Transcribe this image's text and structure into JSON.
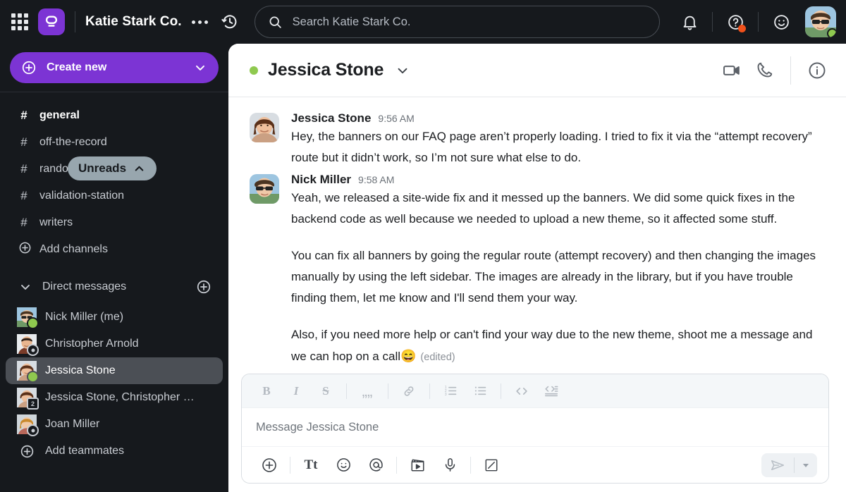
{
  "topbar": {
    "app_launcher_icon": "grid-apps-icon",
    "brand_logo_icon": "pumble-logo-icon",
    "workspace_name": "Katie Stark Co.",
    "more_icon": "ellipsis-icon",
    "history_icon": "history-clock-icon",
    "search": {
      "placeholder": "Search Katie Stark Co.",
      "icon": "search-icon"
    },
    "notifications_icon": "bell-icon",
    "help_icon": "help-question-icon",
    "help_badge": true,
    "status_emoji_icon": "smiley-face-icon",
    "avatar_name": "Nick Miller",
    "avatar_status": "online"
  },
  "sidebar": {
    "create_new": {
      "label": "Create new",
      "plus_icon": "plus-circle-icon",
      "caret_icon": "chevron-down-icon"
    },
    "unreads_pill": {
      "label": "Unreads",
      "icon": "chevron-up-icon"
    },
    "channels": [
      {
        "name": "general",
        "icon": "hash-icon",
        "unread": true
      },
      {
        "name": "off-the-record",
        "icon": "hash-icon",
        "unread": false
      },
      {
        "name": "random",
        "icon": "hash-icon",
        "unread": false
      },
      {
        "name": "validation-station",
        "icon": "hash-icon",
        "unread": false
      },
      {
        "name": "writers",
        "icon": "hash-icon",
        "unread": false
      }
    ],
    "add_channels": {
      "label": "Add channels",
      "icon": "plus-circle-icon"
    },
    "dm_section": {
      "label": "Direct messages",
      "caret_icon": "chevron-down-icon",
      "add_icon": "plus-circle-icon"
    },
    "dms": [
      {
        "name": "Nick Miller (me)",
        "status": "online",
        "selected": false
      },
      {
        "name": "Christopher Arnold",
        "status": "away",
        "selected": false
      },
      {
        "name": "Jessica Stone",
        "status": "online",
        "selected": true
      },
      {
        "name": "Jessica Stone, Christopher …",
        "status": "group",
        "group_count": "2",
        "selected": false
      },
      {
        "name": "Joan Miller",
        "status": "away",
        "selected": false
      }
    ],
    "add_teammates": {
      "label": "Add teammates",
      "icon": "plus-circle-icon"
    }
  },
  "chat": {
    "header": {
      "title": "Jessica Stone",
      "presence": "online",
      "caret_icon": "chevron-down-icon",
      "video_icon": "video-camera-icon",
      "call_icon": "phone-icon",
      "info_icon": "info-circle-icon"
    },
    "messages": [
      {
        "author": "Jessica Stone",
        "time": "9:56 AM",
        "paragraphs": [
          "Hey, the banners on our FAQ page aren’t properly loading. I tried to fix it via the “attempt recovery” route but it didn’t work, so I’m not sure what else to do."
        ],
        "edited": false
      },
      {
        "author": "Nick Miller",
        "time": "9:58 AM",
        "paragraphs": [
          "Yeah, we released a site-wide fix and it messed up the banners. We did some quick fixes in the backend code as well because we needed to upload a new theme, so it affected some stuff.",
          "You can fix all banners by going the regular route (attempt recovery) and then changing the images manually by using the left sidebar. The images are already in the library, but if you have trouble finding them, let me know and I'll send them your way.",
          "Also, if you need more help or can't find your way due to the new theme, shoot me a message and we can hop on a call"
        ],
        "trailing_emoji": "😄",
        "edited": true,
        "edited_label": "(edited)"
      }
    ]
  },
  "composer": {
    "placeholder": "Message Jessica Stone",
    "format_tools": [
      {
        "name": "bold-button",
        "label": "B"
      },
      {
        "name": "italic-button",
        "label": "I"
      },
      {
        "name": "strikethrough-button",
        "label": "S"
      },
      {
        "name": "blockquote-button",
        "label": "❝"
      },
      {
        "name": "link-button",
        "label": "link-icon"
      },
      {
        "name": "ordered-list-button",
        "label": "ordered-list-icon"
      },
      {
        "name": "bullet-list-button",
        "label": "bullet-list-icon"
      },
      {
        "name": "inline-code-button",
        "label": "< >"
      },
      {
        "name": "code-block-button",
        "label": "code-block-icon"
      }
    ],
    "action_tools": [
      {
        "name": "attach-plus-button",
        "label": "plus-circle-icon"
      },
      {
        "name": "format-text-button",
        "label": "Tt"
      },
      {
        "name": "emoji-button",
        "label": "smiley-face-icon"
      },
      {
        "name": "mention-button",
        "label": "at-sign-icon"
      },
      {
        "name": "video-clip-button",
        "label": "clapperboard-icon"
      },
      {
        "name": "voice-record-button",
        "label": "microphone-icon"
      },
      {
        "name": "draw-button",
        "label": "slash-square-icon"
      }
    ],
    "send": {
      "icon": "send-plane-icon",
      "caret_icon": "chevron-down-icon"
    }
  },
  "colors": {
    "brand_purple": "#7c34d4",
    "sidebar_bg": "#16191d",
    "online_green": "#8fc94f",
    "badge_red": "#f1511b",
    "selected_row": "#4b4f55",
    "unreads_pill": "#98a6ae"
  }
}
